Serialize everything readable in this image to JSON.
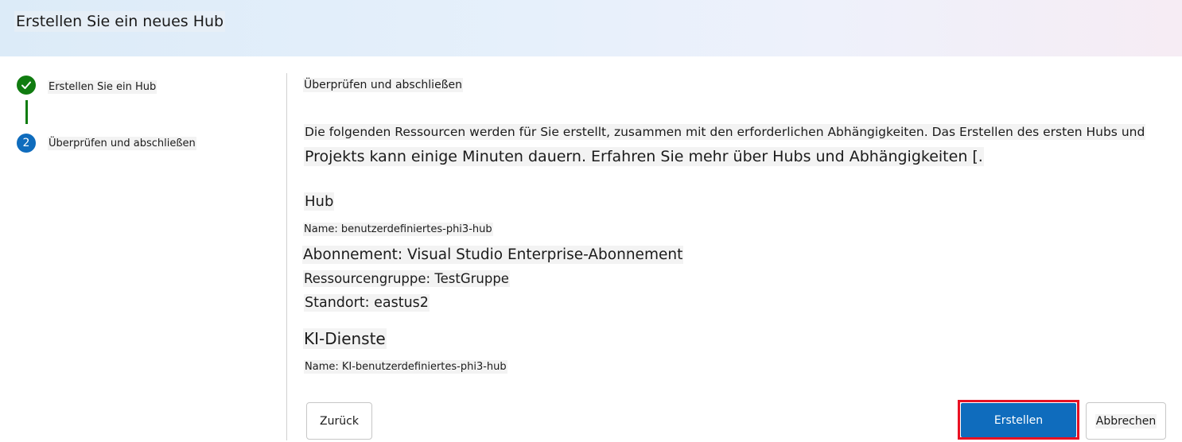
{
  "header": {
    "title": "Erstellen Sie ein neues Hub"
  },
  "steps": [
    {
      "number": "",
      "label": "Erstellen Sie ein Hub",
      "status": "completed",
      "icon": "checkmark-icon"
    },
    {
      "number": "2",
      "label": "Überprüfen und abschließen",
      "status": "current"
    }
  ],
  "main": {
    "section_title": "Überprüfen und abschließen",
    "description_line1": "Die folgenden Ressourcen werden für Sie erstellt, zusammen mit den erforderlichen Abhängigkeiten. Das Erstellen des ersten Hubs und",
    "description_line2": "Projekts kann einige Minuten dauern. Erfahren Sie mehr über Hubs und Abhängigkeiten [.",
    "hub": {
      "title": "Hub",
      "name": "Name: benutzerdefiniertes-phi3-hub",
      "subscription": "Abonnement: Visual Studio Enterprise-Abonnement",
      "resource_group": "Ressourcengruppe: TestGruppe",
      "location": "Standort: eastus2"
    },
    "ai_services": {
      "title": "KI-Dienste",
      "name": "Name: KI-benutzerdefiniertes-phi3-hub"
    }
  },
  "footer": {
    "back_label": "Zurück",
    "create_label": "Erstellen",
    "cancel_label": "Abbrechen"
  },
  "colors": {
    "primary": "#0f6cbd",
    "success": "#107c10",
    "highlight": "#e81123"
  }
}
